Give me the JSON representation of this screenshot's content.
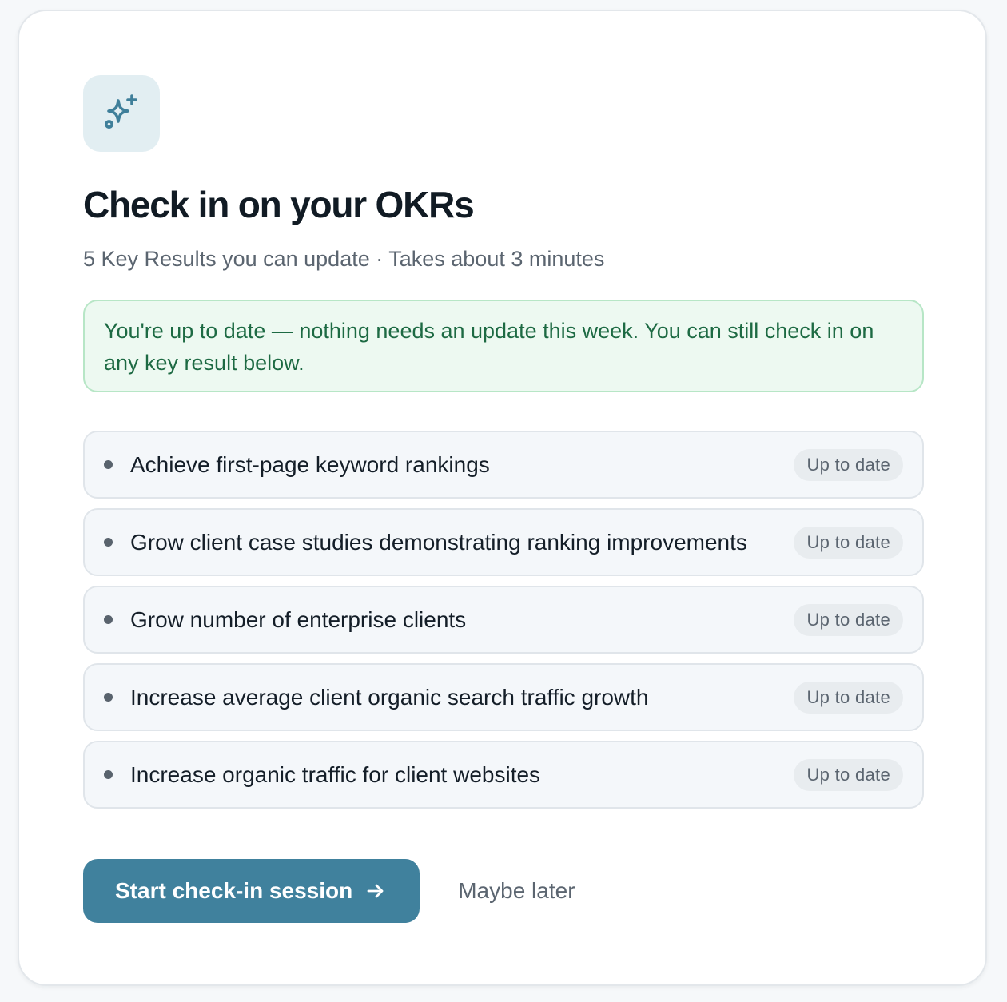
{
  "card": {
    "icon": "sparkles-icon",
    "title": "Check in on your OKRs",
    "subtitle": "5 Key Results you can update · Takes about 3 minutes",
    "notice": "You're up to date — nothing needs an update this week. You can still check in on any key result below."
  },
  "key_results": [
    {
      "label": "Achieve first-page keyword rankings",
      "status": "Up to date"
    },
    {
      "label": "Grow client case studies demonstrating ranking improvements",
      "status": "Up to date"
    },
    {
      "label": "Grow number of enterprise clients",
      "status": "Up to date"
    },
    {
      "label": "Increase average client organic search traffic growth",
      "status": "Up to date"
    },
    {
      "label": "Increase organic traffic for client websites",
      "status": "Up to date"
    }
  ],
  "actions": {
    "primary_label": "Start check-in session",
    "primary_icon": "arrow-right-icon",
    "secondary_label": "Maybe later"
  },
  "colors": {
    "accent": "#40819d",
    "icon_tile": "#e2eef2",
    "notice_bg": "#edf9f1",
    "notice_border": "#b7e6c6",
    "notice_text": "#1d6a43",
    "row_bg": "#f4f7fa",
    "badge_bg": "#e8ecef"
  }
}
